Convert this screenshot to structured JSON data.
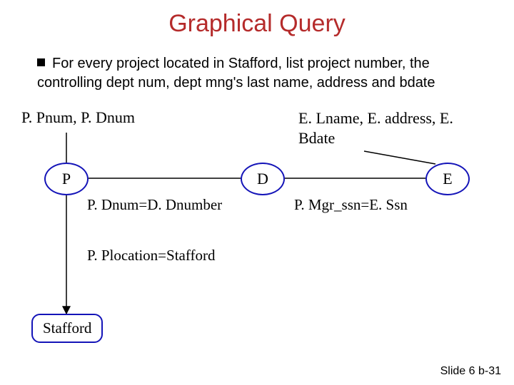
{
  "title": "Graphical Query",
  "bullet": "For every project located in Stafford, list project number, the controlling dept num, dept mng's last name, address and bdate",
  "labels": {
    "left_output": "P. Pnum, P. Dnum",
    "right_output": "E. Lname, E. address, E. Bdate"
  },
  "nodes": {
    "P": "P",
    "D": "D",
    "E": "E"
  },
  "edges": {
    "pd": "P. Dnum=D. Dnumber",
    "de": "P. Mgr_ssn=E. Ssn",
    "ps": "P. Plocation=Stafford"
  },
  "box": "Stafford",
  "footer": "Slide 6 b-31"
}
